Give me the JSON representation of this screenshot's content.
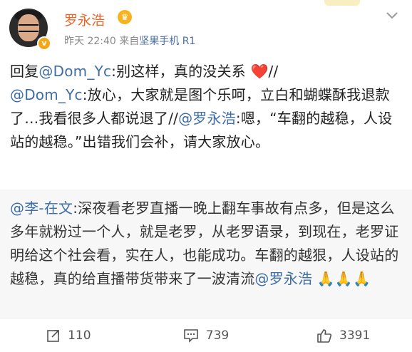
{
  "post": {
    "author": "罗永浩",
    "verified_badge": "v",
    "time": "昨天 22:40",
    "source_prefix": "来自",
    "source": "坚果手机 R1",
    "text": {
      "p1": "回复",
      "m1": "@Dom_Yc",
      "p2": ":别这样，真的没关系 ",
      "heart": "❤️",
      "p3": "//",
      "m2": "@Dom_Yc",
      "p4": ":放心，大家就是图个乐呵，立白和蝴蝶酥我退款了…我看很多人都说退了//",
      "m3": "@罗永浩",
      "p5": ":嗯，“车翻的越稳，人设站的越稳。”出错我们会补，请大家放心。"
    }
  },
  "quoted": {
    "m1": "@李-在文",
    "p1": ":深夜看老罗直播一晚上翻车事故有点多，但是这么多年就粉过一个人，就是老罗，从老罗语录，到现在，老罗证明给这个社会看，实在人，也能成功。车翻的越狠，人设站的越稳，真的给直播带货带来了一波清流",
    "m2": "@罗永浩",
    "claps": "🙏🙏🙏"
  },
  "footer": {
    "repost_count": "110",
    "comment_count": "739",
    "like_count": "3391"
  },
  "colors": {
    "author": "#e8662c",
    "mention": "#3e6ea8",
    "badge": "#f3a716"
  },
  "icons": [
    "crown-icon",
    "chevron-down-icon",
    "repost-icon",
    "comment-icon",
    "like-icon"
  ]
}
